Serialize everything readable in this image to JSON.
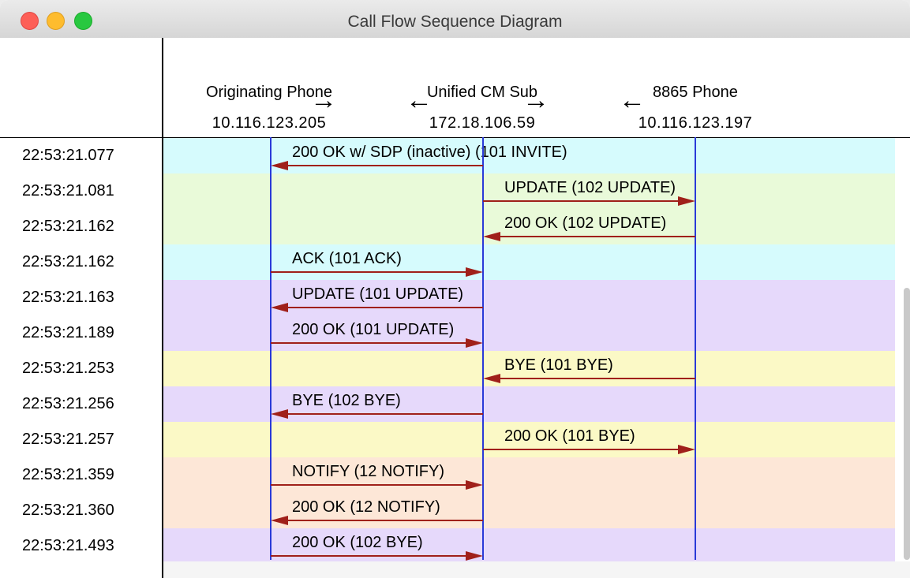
{
  "window": {
    "title": "Call Flow Sequence Diagram"
  },
  "participants": [
    {
      "name": "Originating Phone",
      "ip": "10.116.123.205",
      "arrow": "→"
    },
    {
      "name": "Unified CM Sub",
      "ip": "172.18.106.59",
      "arrow": "←"
    },
    {
      "name": "8865 Phone",
      "ip": "10.116.123.197",
      "arrow": "→"
    }
  ],
  "extra_header_arrow": "←",
  "colors": {
    "cyan": "#d6fbfd",
    "green": "#e9fad9",
    "purple": "#e6d9fb",
    "yellow": "#fbf9c6",
    "peach": "#fde7d7",
    "lifeline": "#2a3ad8",
    "arrow": "#a0201a"
  },
  "messages": [
    {
      "time": "22:53:21.077",
      "label": "200 OK w/ SDP (inactive)  (101 INVITE)",
      "from": 1,
      "to": 0,
      "band": "cyan"
    },
    {
      "time": "22:53:21.081",
      "label": "UPDATE (102 UPDATE)",
      "from": 1,
      "to": 2,
      "band": "green"
    },
    {
      "time": "22:53:21.162",
      "label": "200 OK (102 UPDATE)",
      "from": 2,
      "to": 1,
      "band": "green"
    },
    {
      "time": "22:53:21.162",
      "label": "ACK (101 ACK)",
      "from": 0,
      "to": 1,
      "band": "cyan"
    },
    {
      "time": "22:53:21.163",
      "label": "UPDATE (101 UPDATE)",
      "from": 1,
      "to": 0,
      "band": "purple"
    },
    {
      "time": "22:53:21.189",
      "label": "200 OK (101 UPDATE)",
      "from": 0,
      "to": 1,
      "band": "purple"
    },
    {
      "time": "22:53:21.253",
      "label": "BYE (101 BYE)",
      "from": 2,
      "to": 1,
      "band": "yellow"
    },
    {
      "time": "22:53:21.256",
      "label": "BYE (102 BYE)",
      "from": 1,
      "to": 0,
      "band": "purple"
    },
    {
      "time": "22:53:21.257",
      "label": "200 OK (101 BYE)",
      "from": 1,
      "to": 2,
      "band": "yellow"
    },
    {
      "time": "22:53:21.359",
      "label": "NOTIFY (12 NOTIFY)",
      "from": 0,
      "to": 1,
      "band": "peach"
    },
    {
      "time": "22:53:21.360",
      "label": "200 OK (12 NOTIFY)",
      "from": 1,
      "to": 0,
      "band": "peach"
    },
    {
      "time": "22:53:21.493",
      "label": "200 OK (102 BYE)",
      "from": 0,
      "to": 1,
      "band": "purple"
    }
  ]
}
